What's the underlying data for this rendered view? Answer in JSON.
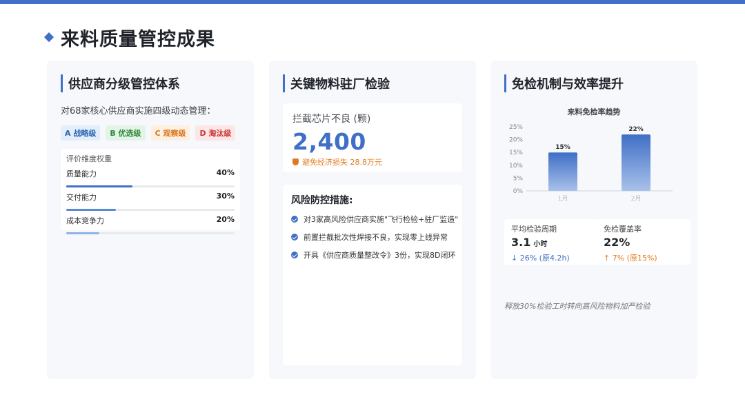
{
  "page": {
    "title": "来料质量管控成果",
    "accent": "#3f6fc6"
  },
  "panel1": {
    "header": "供应商分级管控体系",
    "intro": "对68家核心供应商实施四级动态管理：",
    "grades": [
      {
        "label": "A 战略级",
        "color": "#2c64b4"
      },
      {
        "label": "B 优选级",
        "color": "#2f8a3a"
      },
      {
        "label": "C 观察级",
        "color": "#d9761c"
      },
      {
        "label": "D 淘汰级",
        "color": "#cc3333"
      }
    ],
    "weights_title": "评价维度权重",
    "weights": [
      {
        "name": "质量能力",
        "value": "40%",
        "fraction": 0.4,
        "color": "#3f6fc6"
      },
      {
        "name": "交付能力",
        "value": "30%",
        "fraction": 0.3,
        "color": "#5b88d3"
      },
      {
        "name": "成本竞争力",
        "value": "20%",
        "fraction": 0.2,
        "color": "#8fb2e6"
      }
    ]
  },
  "panel2": {
    "header": "关键物料驻厂检验",
    "stat_label": "拦截芯片不良 (颗)",
    "stat_value": "2,400",
    "stat_note": "避免经济损失 28.8万元",
    "measures_title": "风险防控措施:",
    "measures": [
      "对3家高风险供应商实施\"飞行检验+驻厂监造\"",
      "前置拦截批次性焊接不良，实现零上线异常",
      "开具《供应商质量整改令》3份，实现8D闭环"
    ]
  },
  "panel3": {
    "header": "免检机制与效率提升",
    "kpis": [
      {
        "label": "平均检验周期",
        "value": "3.1",
        "unit": "小时",
        "delta": "↓ 26% (原4.2h)",
        "delta_color": "#3f6fc6"
      },
      {
        "label": "免检覆盖率",
        "value": "22%",
        "unit": "",
        "delta": "↑ 7% (原15%)",
        "delta_color": "#e07a1e"
      }
    ],
    "footnote": "释放30%检验工时转向高风险物料加严检验"
  },
  "chart_data": {
    "type": "bar",
    "title": "来料免检率趋势",
    "categories": [
      "1月",
      "2月"
    ],
    "values": [
      15,
      22
    ],
    "data_labels": [
      "15%",
      "22%"
    ],
    "y_ticks": [
      "0%",
      "5%",
      "10%",
      "15%",
      "20%",
      "25%"
    ],
    "ylim": [
      0,
      25
    ],
    "xlabel": "",
    "ylabel": "",
    "grid": false,
    "bar_color": "#3f6fc6"
  }
}
